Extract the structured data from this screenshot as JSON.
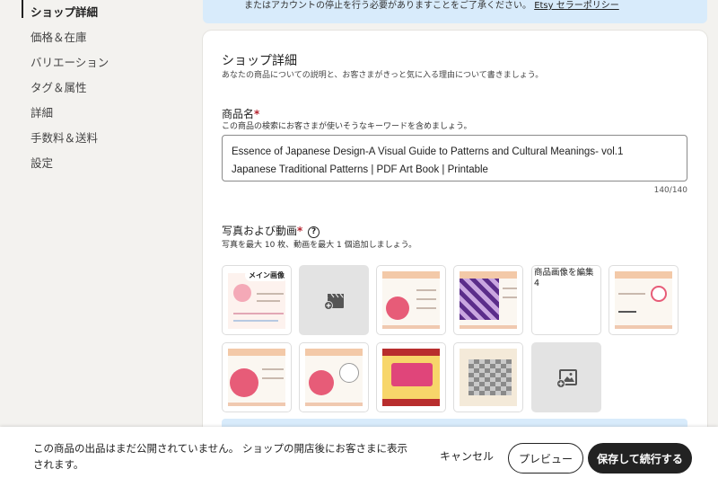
{
  "sidebar": {
    "items": [
      {
        "label": "ショップ詳細"
      },
      {
        "label": "価格＆在庫"
      },
      {
        "label": "バリエーション"
      },
      {
        "label": "タグ＆属性"
      },
      {
        "label": "詳細"
      },
      {
        "label": "手数料＆送料"
      },
      {
        "label": "設定"
      }
    ]
  },
  "banner": {
    "text": "またはアカウントの停止を行う必要がありますことをご了承ください。",
    "link": "Etsy セラーポリシー"
  },
  "section": {
    "title": "ショップ詳細",
    "subtitle": "あなたの商品についての説明と、お客さまがきっと気に入る理由について書きましょう。"
  },
  "product_name": {
    "label": "商品名",
    "required_mark": "*",
    "hint": "この商品の検索にお客さまが使いそうなキーワードを含めましょう。",
    "value_line1": "Essence of Japanese Design-A Visual Guide to Patterns  and Cultural Meanings- vol.1",
    "value_line2": "Japanese Traditional Patterns | PDF Art Book | Printable",
    "counter": "140/140"
  },
  "media": {
    "label": "写真および動画",
    "required_mark": "*",
    "help": "?",
    "hint": "写真を最大 10 枚、動画を最大 1 個追加しましょう。",
    "main_image_label": "メイン画像",
    "edit_label": "商品画像を編集",
    "edit_index": "4"
  },
  "bottom_bar": {
    "notice": "この商品の出品はまだ公開されていません。 ショップの開店後にお客さまに表示されます。",
    "cancel": "キャンセル",
    "preview": "プレビュー",
    "save": "保存して続行する"
  }
}
